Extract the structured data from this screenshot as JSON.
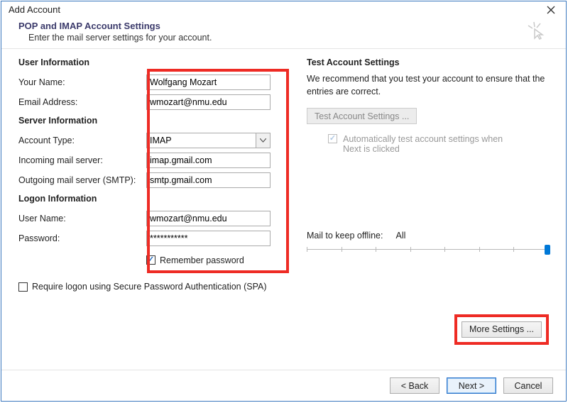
{
  "window": {
    "title": "Add Account"
  },
  "header": {
    "title": "POP and IMAP Account Settings",
    "subtitle": "Enter the mail server settings for your account."
  },
  "sections": {
    "user": "User Information",
    "server": "Server Information",
    "logon": "Logon Information"
  },
  "labels": {
    "your_name": "Your Name:",
    "email": "Email Address:",
    "account_type": "Account Type:",
    "incoming": "Incoming mail server:",
    "outgoing": "Outgoing mail server (SMTP):",
    "username": "User Name:",
    "password": "Password:",
    "remember": "Remember password",
    "spa": "Require logon using Secure Password Authentication (SPA)"
  },
  "values": {
    "your_name": "Wolfgang Mozart",
    "email": "wmozart@nmu.edu",
    "account_type": "IMAP",
    "incoming": "imap.gmail.com",
    "outgoing": "smtp.gmail.com",
    "username": "wmozart@nmu.edu",
    "password": "***********"
  },
  "right": {
    "title": "Test Account Settings",
    "desc": "We recommend that you test your account to ensure that the entries are correct.",
    "test_btn": "Test Account Settings ...",
    "auto_test": "Automatically test account settings when Next is clicked",
    "offline_label": "Mail to keep offline:",
    "offline_value": "All",
    "more_btn": "More Settings ..."
  },
  "footer": {
    "back": "<  Back",
    "next": "Next  >",
    "cancel": "Cancel"
  }
}
